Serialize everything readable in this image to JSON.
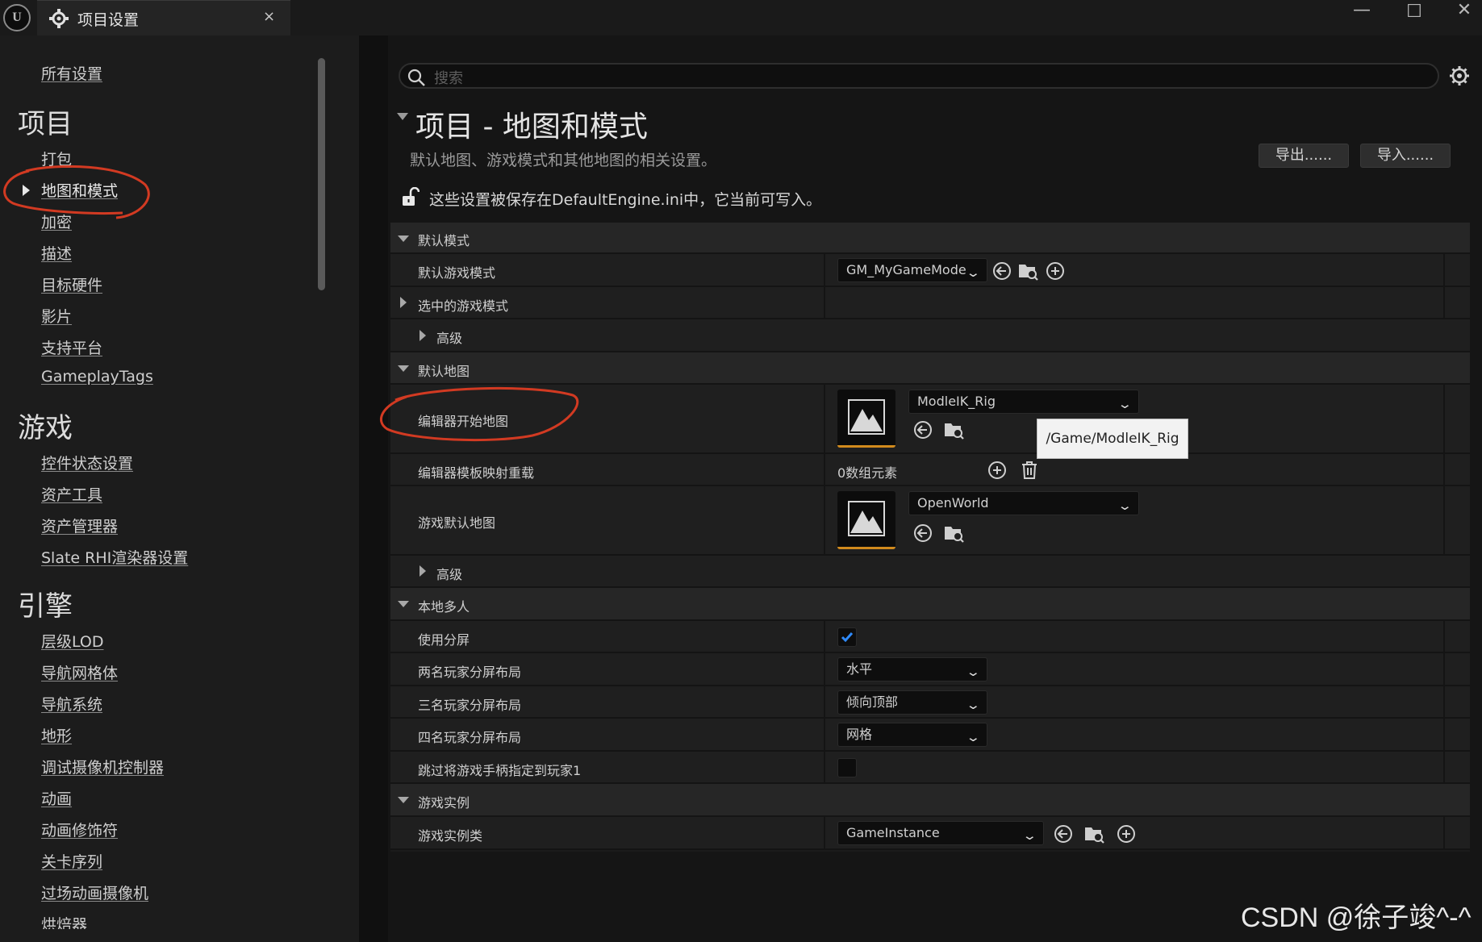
{
  "window": {
    "tab_title": "项目设置",
    "close_glyph": "×",
    "logo_glyph": "U",
    "minimize_glyph": "—",
    "maximize_glyph": "☐",
    "close_window_glyph": "✕"
  },
  "sidebar": {
    "all_settings": "所有设置",
    "categories": [
      {
        "title": "项目",
        "items": [
          "打包",
          "地图和模式",
          "加密",
          "描述",
          "目标硬件",
          "影片",
          "支持平台",
          "GameplayTags"
        ]
      },
      {
        "title": "游戏",
        "items": [
          "控件状态设置",
          "资产工具",
          "资产管理器",
          "Slate RHI渲染器设置"
        ]
      },
      {
        "title": "引擎",
        "items": [
          "层级LOD",
          "导航网格体",
          "导航系统",
          "地形",
          "调试摄像机控制器",
          "动画",
          "动画修饰符",
          "关卡序列",
          "过场动画摄像机",
          "烘焙器"
        ]
      }
    ],
    "selected_item": "地图和模式"
  },
  "search": {
    "placeholder": "搜索"
  },
  "header": {
    "title": "项目 - 地图和模式",
    "description": "默认地图、游戏模式和其他地图的相关设置。",
    "export_label": "导出......",
    "import_label": "导入......",
    "saved_note": "这些设置被保存在DefaultEngine.ini中，它当前可写入。"
  },
  "grid": {
    "default_modes": {
      "label": "默认模式",
      "default_game_mode_label": "默认游戏模式",
      "default_game_mode_value": "GM_MyGameMode",
      "selected_game_mode_label": "选中的游戏模式",
      "advanced_label": "高级"
    },
    "default_maps": {
      "label": "默认地图",
      "editor_startup_map_label": "编辑器开始地图",
      "editor_startup_map_value": "ModleIK_Rig",
      "editor_startup_map_tooltip": "/Game/ModleIK_Rig",
      "editor_template_override_label": "编辑器模板映射重载",
      "editor_template_override_value": "0数组元素",
      "game_default_map_label": "游戏默认地图",
      "game_default_map_value": "OpenWorld",
      "advanced_label": "高级"
    },
    "local_multiplayer": {
      "label": "本地多人",
      "use_splitscreen_label": "使用分屏",
      "use_splitscreen_checked": true,
      "two_player_label": "两名玩家分屏布局",
      "two_player_value": "水平",
      "three_player_label": "三名玩家分屏布局",
      "three_player_value": "倾向顶部",
      "four_player_label": "四名玩家分屏布局",
      "four_player_value": "网格",
      "skip_gamepad_label": "跳过将游戏手柄指定到玩家1",
      "skip_gamepad_checked": false
    },
    "game_instance": {
      "label": "游戏实例",
      "game_instance_class_label": "游戏实例类",
      "game_instance_class_value": "GameInstance"
    }
  },
  "watermark": "CSDN @徐子竣^-^",
  "colors": {
    "annotation_red": "#d23a22",
    "accent_orange": "#d28b1d",
    "check_blue": "#2f8bff"
  },
  "icons": [
    "unreal-logo-icon",
    "project-settings-icon",
    "search-icon",
    "settings-gear-icon",
    "unlock-icon",
    "browse-back-arrow-icon",
    "browse-folder-icon",
    "add-plus-icon",
    "trash-icon",
    "map-thumbnail-icon",
    "chevron-down-icon",
    "checkmark-icon"
  ]
}
